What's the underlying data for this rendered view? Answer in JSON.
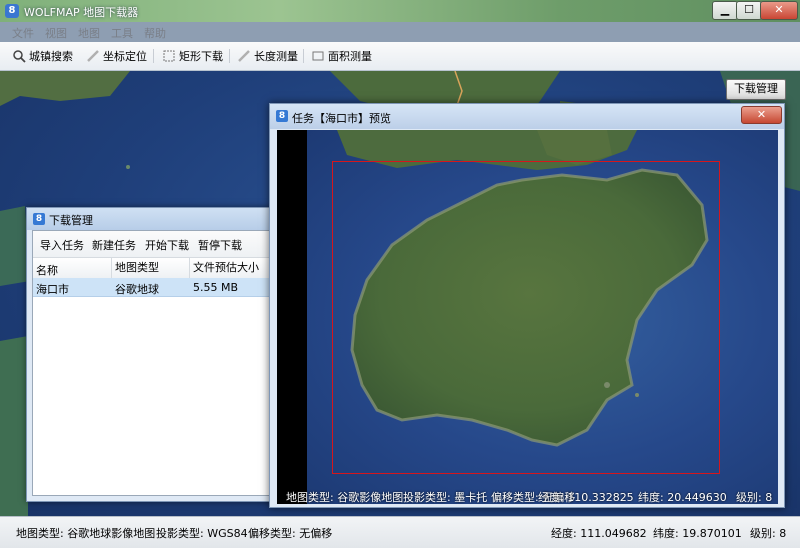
{
  "window": {
    "title": "WOLFMAP 地图下载器",
    "app_icon": "8",
    "minimize_glyph": "▁",
    "maximize_glyph": "☐",
    "close_glyph": "✕"
  },
  "menu": {
    "items": [
      "文件",
      "视图",
      "地图",
      "工具",
      "帮助"
    ]
  },
  "toolbar": {
    "search": "城镇搜索",
    "locate": "坐标定位",
    "rect_download": "矩形下载",
    "length": "长度测量",
    "area": "面积测量"
  },
  "download_manage_button": "下载管理",
  "download_dialog": {
    "title": "下载管理",
    "icon": "8",
    "actions": [
      "导入任务",
      "新建任务",
      "开始下载",
      "暂停下载"
    ],
    "columns": [
      "名称",
      "地图类型",
      "文件预估大小"
    ],
    "rows": [
      {
        "name": "海口市",
        "map_type": "谷歌地球",
        "size": "5.55 MB"
      }
    ]
  },
  "preview": {
    "title": "任务【海口市】预览",
    "icon": "8",
    "close_glyph": "✕",
    "status": {
      "map_type": "地图类型: 谷歌影像地图",
      "projection": "投影类型: 墨卡托",
      "offset": "偏移类型: 无偏移",
      "longitude": "经度: 110.332825",
      "latitude": "纬度:   20.449630",
      "level": "级别: 8"
    }
  },
  "statusbar": {
    "map_type": "地图类型: 谷歌地球影像地图",
    "projection": "投影类型: WGS84",
    "offset": "偏移类型: 无偏移",
    "longitude": "经度:   111.049682",
    "latitude": "纬度:   19.870101",
    "level": "级别: 8"
  },
  "colors": {
    "selection_rect": "#d6161c",
    "ocean": "#24488a",
    "land": "#4f6d3c"
  }
}
